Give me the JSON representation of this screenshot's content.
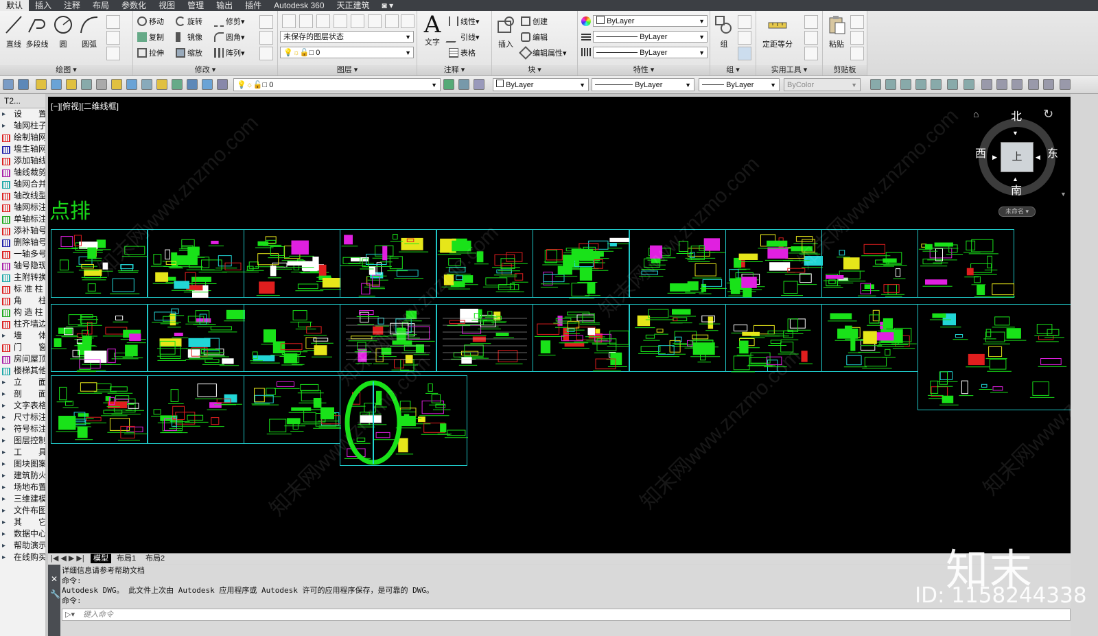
{
  "menu": [
    "默认",
    "插入",
    "注释",
    "布局",
    "参数化",
    "视图",
    "管理",
    "输出",
    "插件",
    "Autodesk 360",
    "天正建筑"
  ],
  "ribbon": {
    "draw": {
      "title": "绘图",
      "line": "直线",
      "polyline": "多段线",
      "circle": "圆",
      "arc": "圆弧"
    },
    "modify": {
      "title": "修改",
      "move": "移动",
      "rotate": "旋转",
      "trim": "修剪",
      "copy": "复制",
      "mirror": "镜像",
      "fillet": "圆角",
      "stretch": "拉伸",
      "scale": "缩放",
      "array": "阵列"
    },
    "layer": {
      "title": "图层",
      "state": "未保存的图层状态",
      "current": "0"
    },
    "annotation": {
      "title": "注释",
      "text": "文字",
      "linear": "线性",
      "leader": "引线",
      "table": "表格"
    },
    "block": {
      "title": "块",
      "insert": "插入",
      "create": "创建",
      "edit": "编辑",
      "edit_attr": "编辑属性"
    },
    "properties": {
      "title": "特性",
      "color": "ByLayer",
      "linetype": "ByLayer",
      "lineweight": "ByLayer"
    },
    "group": {
      "title": "组",
      "group": "组"
    },
    "utilities": {
      "title": "实用工具",
      "measure": "定距等分"
    },
    "clipboard": {
      "title": "剪贴板",
      "paste": "粘贴"
    }
  },
  "toolbar": {
    "layer": "0",
    "color": "ByLayer",
    "linetype": "ByLayer",
    "lineweight": "ByLayer",
    "plotstyle": "ByColor"
  },
  "palette": {
    "title": "T2...",
    "items": [
      "设　　置",
      "轴网柱子",
      "绘制轴网",
      "墙生轴网",
      "添加轴线",
      "轴线裁剪",
      "轴网合并",
      "轴改线型",
      "轴网标注",
      "单轴标注",
      "添补轴号",
      "删除轴号",
      "一轴多号",
      "轴号隐现",
      "主附转换",
      "标 准 柱",
      "角　　柱",
      "构 造 柱",
      "柱齐墙边",
      "墙　　体",
      "门　　窗",
      "房间屋顶",
      "楼梯其他",
      "立　　面",
      "剖　　面",
      "文字表格",
      "尺寸标注",
      "符号标注",
      "图层控制",
      "工　　具",
      "图块图案",
      "建筑防火",
      "场地布置",
      "三维建模",
      "文件布图",
      "其　　它",
      "数据中心",
      "帮助演示",
      "在线购买"
    ]
  },
  "viewport": {
    "label": "[−][俯视][二维线框]",
    "hand_text": "点排"
  },
  "viewcube": {
    "north": "北",
    "south": "南",
    "east": "东",
    "west": "西",
    "face": "上",
    "named_view": "未命名"
  },
  "layout_tabs": [
    "模型",
    "布局1",
    "布局2"
  ],
  "command": {
    "lines": [
      "详细信息请参考帮助文档",
      "命令:",
      "Autodesk DWG。  此文件上次由 Autodesk 应用程序或 Autodesk 许可的应用程序保存，是可靠的 DWG。",
      "命令:"
    ],
    "placeholder": "键入命令"
  },
  "watermark": {
    "brand": "知末",
    "id": "ID: 1158244338",
    "site": "知末网www.znzmo.com"
  },
  "colors": {
    "frame": "#1fc7c7",
    "green": "#19e219",
    "white": "#ffffff",
    "magenta": "#e020e0",
    "red": "#e01e1e",
    "yellow": "#e6e61a",
    "cyan": "#22d6d6"
  }
}
